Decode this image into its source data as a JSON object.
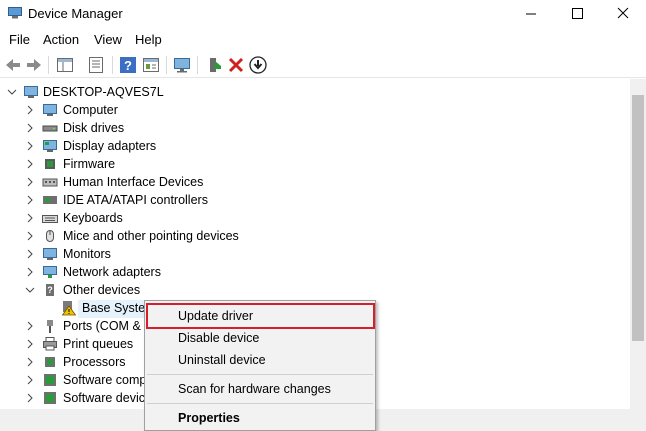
{
  "window": {
    "title": "Device Manager"
  },
  "menu": [
    "File",
    "Action",
    "View",
    "Help"
  ],
  "tree": {
    "root": "DESKTOP-AQVES7L",
    "items": [
      "Computer",
      "Disk drives",
      "Display adapters",
      "Firmware",
      "Human Interface Devices",
      "IDE ATA/ATAPI controllers",
      "Keyboards",
      "Mice and other pointing devices",
      "Monitors",
      "Network adapters",
      "Other devices",
      "Base System",
      "Ports (COM &",
      "Print queues",
      "Processors",
      "Software comp",
      "Software device"
    ]
  },
  "context_menu": {
    "update": "Update driver",
    "disable": "Disable device",
    "uninstall": "Uninstall device",
    "scan": "Scan for hardware changes",
    "properties": "Properties"
  },
  "colors": {
    "highlight": "#d61f2c",
    "selection": "#e5f1fb"
  }
}
